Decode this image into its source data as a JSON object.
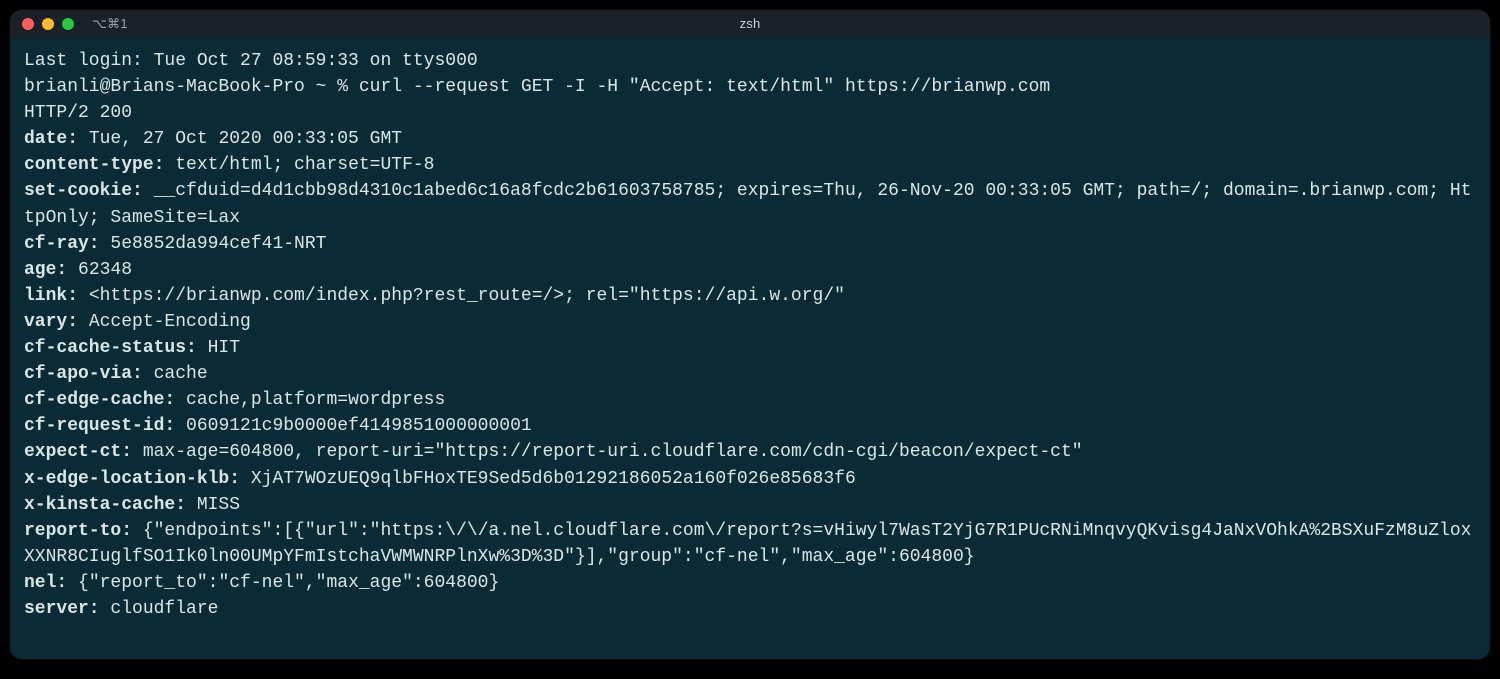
{
  "window": {
    "tab_label": "⌥⌘1",
    "title": "zsh"
  },
  "term": {
    "last_login": "Last login: Tue Oct 27 08:59:33 on ttys000",
    "prompt": "brianli@Brians-MacBook-Pro ~ % ",
    "command": "curl --request GET -I -H \"Accept: text/html\" https://brianwp.com",
    "status_line": "HTTP/2 200",
    "headers": [
      {
        "k": "date:",
        "v": " Tue, 27 Oct 2020 00:33:05 GMT"
      },
      {
        "k": "content-type:",
        "v": " text/html; charset=UTF-8"
      },
      {
        "k": "set-cookie:",
        "v": " __cfduid=d4d1cbb98d4310c1abed6c16a8fcdc2b61603758785; expires=Thu, 26-Nov-20 00:33:05 GMT; path=/; domain=.brianwp.com; HttpOnly; SameSite=Lax"
      },
      {
        "k": "cf-ray:",
        "v": " 5e8852da994cef41-NRT"
      },
      {
        "k": "age:",
        "v": " 62348"
      },
      {
        "k": "link:",
        "v": " <https://brianwp.com/index.php?rest_route=/>; rel=\"https://api.w.org/\""
      },
      {
        "k": "vary:",
        "v": " Accept-Encoding"
      },
      {
        "k": "cf-cache-status:",
        "v": " HIT"
      },
      {
        "k": "cf-apo-via:",
        "v": " cache"
      },
      {
        "k": "cf-edge-cache:",
        "v": " cache,platform=wordpress"
      },
      {
        "k": "cf-request-id:",
        "v": " 0609121c9b0000ef4149851000000001"
      },
      {
        "k": "expect-ct:",
        "v": " max-age=604800, report-uri=\"https://report-uri.cloudflare.com/cdn-cgi/beacon/expect-ct\""
      },
      {
        "k": "x-edge-location-klb:",
        "v": " XjAT7WOzUEQ9qlbFHoxTE9Sed5d6b01292186052a160f026e85683f6"
      },
      {
        "k": "x-kinsta-cache:",
        "v": " MISS"
      },
      {
        "k": "report-to:",
        "v": " {\"endpoints\":[{\"url\":\"https:\\/\\/a.nel.cloudflare.com\\/report?s=vHiwyl7WasT2YjG7R1PUcRNiMnqvyQKvisg4JaNxVOhkA%2BSXuFzM8uZloxXXNR8CIuglfSO1Ik0ln00UMpYFmIstchaVWMWNRPlnXw%3D%3D\"}],\"group\":\"cf-nel\",\"max_age\":604800}"
      },
      {
        "k": "nel:",
        "v": " {\"report_to\":\"cf-nel\",\"max_age\":604800}"
      },
      {
        "k": "server:",
        "v": " cloudflare"
      }
    ]
  }
}
